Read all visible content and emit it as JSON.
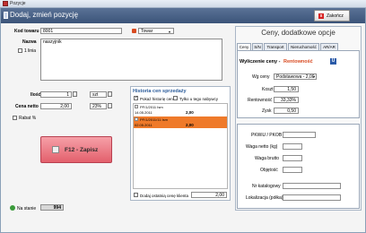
{
  "window": {
    "title": "Pozycje"
  },
  "header": {
    "title": "Dodaj, zmień pozycję",
    "close_label": "Zakończ",
    "close_x": "x"
  },
  "form": {
    "code_label": "Kod towaru",
    "code_value": "8001",
    "type_value": "Towar",
    "name_label": "Nazwa",
    "name_value": "naszyjnik",
    "line1_label": "1 linia",
    "qty_label": "Ilość",
    "qty_value": "1",
    "unit_value": "szt",
    "net_price_label": "Cena netto",
    "net_price_value": "2,00",
    "vat_value": "23%",
    "discount_label": "Rabat %",
    "save_label": "F12 - Zapisz",
    "stock_label": "Na stanie",
    "stock_value": "994"
  },
  "history": {
    "title": "Historia cen sprzedaży",
    "show_history_label": "Pokaż historię cen",
    "only_buyer_label": "Tylko u tego nabywcy",
    "rows": [
      {
        "doc": "PF/1/2011 Ism",
        "date": "14.05.2011",
        "price": "2,00"
      },
      {
        "doc": "PF/1/2011/11 Ism",
        "date": "02.05.2011",
        "price": "2,00"
      }
    ],
    "add_last_label": "Dodaj ostatnią cenę klienta",
    "last_value": "2,00"
  },
  "options": {
    "title": "Ceny, dodatkowe opcje",
    "tabs": [
      "Ceny",
      "S/N",
      "Transport",
      "Nieruchomość",
      "AR/AR"
    ],
    "calc_label": "Wyliczenie ceny -",
    "calc_mode": "Rentowność",
    "info_icon": "U",
    "price_by_label": "Wg ceny",
    "price_by_value": "Podstawowa - 2,00",
    "cost_label": "Koszt",
    "cost_value": "1,50",
    "profit_label": "Rentowność",
    "profit_value": "33,33%",
    "gain_label": "Zysk",
    "gain_value": "0,50",
    "pkwiu_label": "PKWiU / PKOB",
    "net_weight_label": "Waga netto (kg)",
    "gross_weight_label": "Waga brutto",
    "volume_label": "Objętość",
    "catalog_label": "Nr katalogowy",
    "location_label": "Lokalizacja (półka)"
  }
}
